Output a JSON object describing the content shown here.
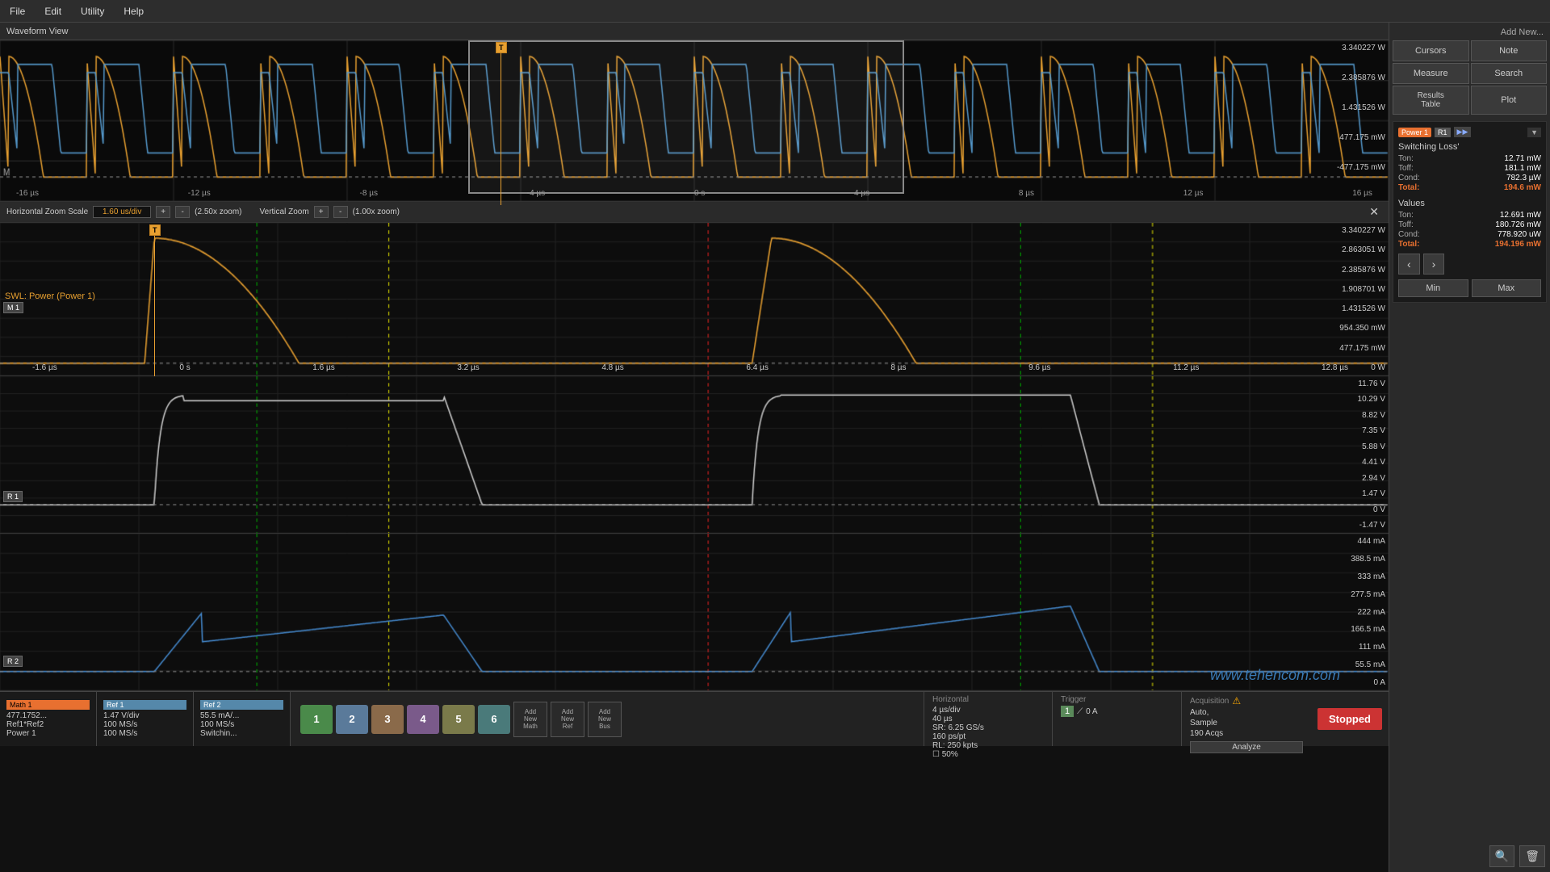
{
  "menuBar": {
    "items": [
      "File",
      "Edit",
      "Utility",
      "Help"
    ]
  },
  "waveformHeader": {
    "title": "Waveform View"
  },
  "overviewTimeAxis": {
    "labels": [
      "-16 µs",
      "-12 µs",
      "-8 µs",
      "-4 µs",
      "0 s",
      "4 µs",
      "8 µs",
      "12 µs",
      "16 µs"
    ]
  },
  "overviewYLabels": {
    "values": [
      "3.340227 W",
      "2.385876 W",
      "1.431526 W",
      "477.175 mW",
      "-477.175 mW"
    ]
  },
  "zoomControls": {
    "hzoomLabel": "Horizontal Zoom Scale",
    "hzoomValue": "1.60 us/div",
    "hzoomInfo": "(2.50x zoom)",
    "vzoomLabel": "Vertical Zoom",
    "vzoomInfo": "(1.00x zoom)",
    "plusBtn": "+",
    "minusBtn": "-"
  },
  "zoomPanel": {
    "timeLabels": [
      "-1.6 µs",
      "0 s",
      "1.6 µs",
      "3.2 µs",
      "4.8 µs",
      "6.4 µs",
      "8 µs",
      "9.6 µs",
      "11.2 µs",
      "12.8 µs"
    ],
    "yLabels": [
      "3.340227 W",
      "2.863051 W",
      "2.385876 W",
      "1.908701 W",
      "1.431526 W",
      "954.350 mW",
      "477.175 mW",
      "0 W"
    ],
    "swlLabel": "SWL: Power (Power 1)",
    "m1Label": "M 1"
  },
  "voltagePanel": {
    "yLabels": [
      "11.76 V",
      "10.29 V",
      "8.82 V",
      "7.35 V",
      "5.88 V",
      "4.41 V",
      "2.94 V",
      "1.47 V",
      "0 V",
      "-1.47 V"
    ],
    "r1Label": "R 1"
  },
  "currentPanel": {
    "yLabels": [
      "444 mA",
      "388.5 mA",
      "333 mA",
      "277.5 mA",
      "222 mA",
      "166.5 mA",
      "111 mA",
      "55.5 mA",
      "0 A"
    ],
    "r2Label": "R 2",
    "watermark": "www.tehencom.com"
  },
  "sidebar": {
    "addNewLabel": "Add New...",
    "cursorsLabel": "Cursors",
    "noteLabel": "Note",
    "measureLabel": "Measure",
    "searchLabel": "Search",
    "resultsTableLabel": "Results\nTable",
    "plotLabel": "Plot",
    "power1": {
      "label": "Power 1",
      "r1Badge": "R1",
      "menuBadge": "▼▶",
      "switchingLossTitle": "Switching Loss'",
      "ton": "12.71 mW",
      "toff": "181.1 mW",
      "cond": "782.3 µW",
      "total": "194.6 mW",
      "valuesTitle": "Values",
      "vton": "12.691 mW",
      "vtoff": "180.726 mW",
      "vcond": "778.920 uW",
      "vtotal": "194.196 mW",
      "prevBtn": "‹",
      "nextBtn": "›",
      "minBtn": "Min",
      "maxBtn": "Max"
    }
  },
  "bottomBar": {
    "math1": {
      "label": "Math 1",
      "line1": "477.1752...",
      "line2": "Ref1*Ref2",
      "line3": "Power 1"
    },
    "ref1": {
      "label": "Ref 1",
      "line1": "1.47 V/div",
      "line2": "100 MS/s",
      "line3": "100 MS/s"
    },
    "ref2": {
      "label": "Ref 2",
      "line1": "55.5 mA/...",
      "line2": "100 MS/s",
      "line3": "Switchin..."
    },
    "channels": [
      "1",
      "2",
      "3",
      "4",
      "5",
      "6"
    ],
    "addMath": "Add\nNew\nMath",
    "addRef": "Add\nNew\nRef",
    "addBus": "Add\nNew\nBus",
    "horizontal": {
      "label": "Horizontal",
      "line1": "4 µs/div",
      "line2": "40 µs",
      "sr": "SR: 6.25 GS/s",
      "pts": "160 ps/pt",
      "rl": "RL: 250 kpts",
      "zoom": "☐ 50%"
    },
    "trigger": {
      "label": "Trigger",
      "ch": "1",
      "value": "0 A"
    },
    "acquisition": {
      "label": "Acquisition",
      "mode1": "Auto,",
      "mode2": "Sample",
      "acqs": "190 Acqs",
      "analyzeBtn": "Analyze"
    },
    "stoppedBtn": "Stopped"
  }
}
